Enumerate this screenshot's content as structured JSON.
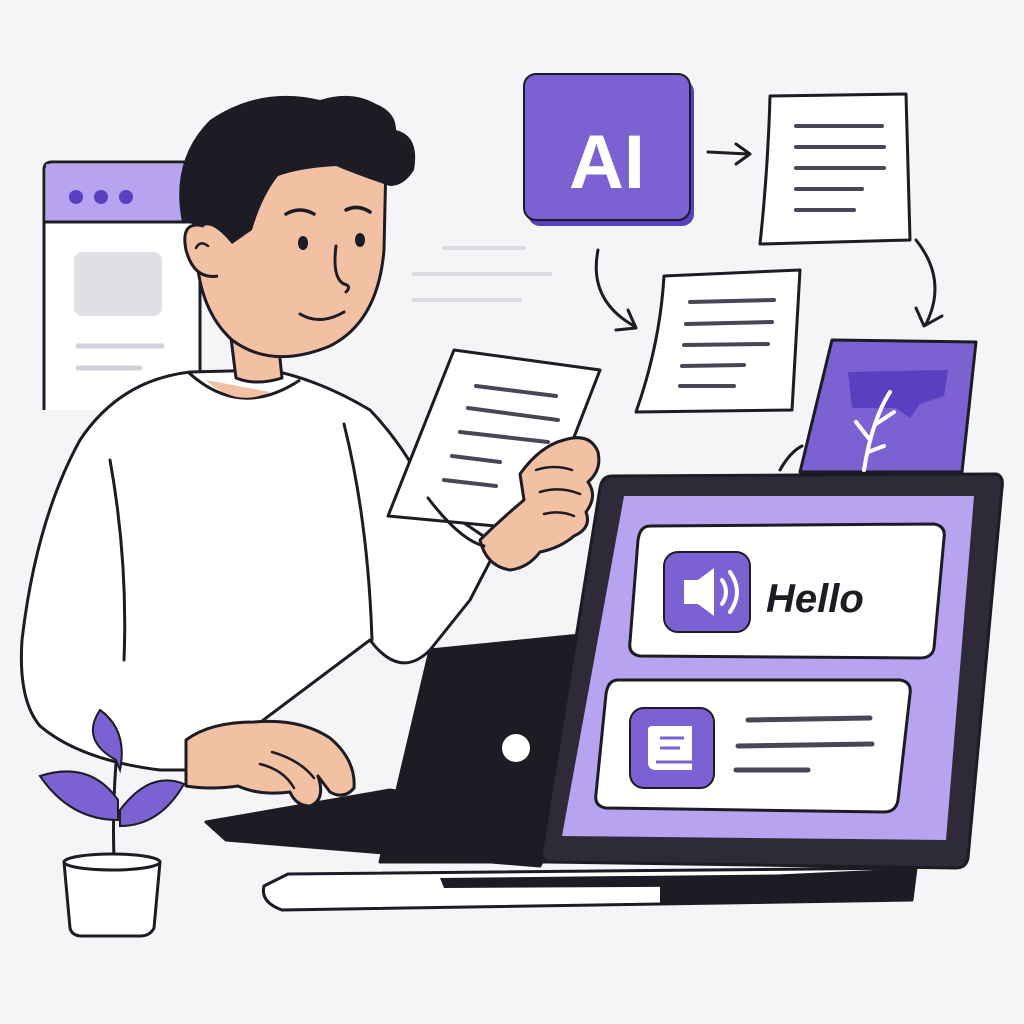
{
  "ai_badge": {
    "label": "AI"
  },
  "laptop_screen": {
    "card1": {
      "text": "Hello",
      "icon": "speaker-icon"
    },
    "card2": {
      "icon": "book-icon"
    }
  },
  "colors": {
    "accent": "#7b61d1",
    "accent_light": "#b7a3ef",
    "ink": "#1d1b24",
    "skin": "#f2c1a3",
    "background": "#f5f4f6"
  }
}
